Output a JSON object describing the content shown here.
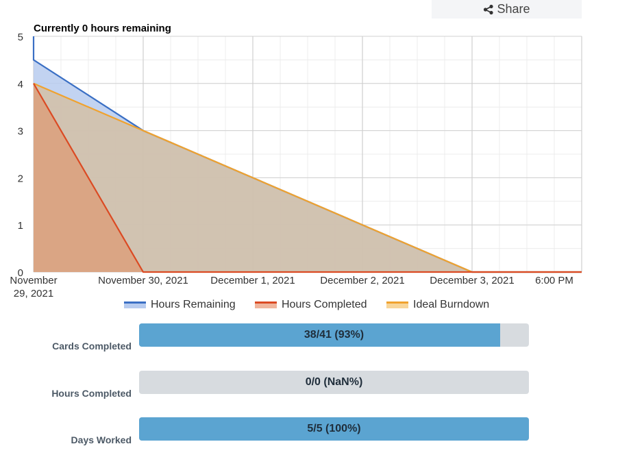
{
  "share": {
    "label": "Share",
    "icon": "share-icon"
  },
  "chart_data": {
    "type": "area",
    "title": "Currently 0 hours remaining",
    "xlabel": "",
    "ylabel": "",
    "ylim": [
      0,
      5
    ],
    "yticks": [
      0,
      1,
      2,
      3,
      4,
      5
    ],
    "grid": true,
    "legend_position": "bottom",
    "x_ticks": [
      {
        "x": "2021-11-29 00:00",
        "label": "November 29, 2021"
      },
      {
        "x": "2021-11-30 00:00",
        "label": "November 30, 2021"
      },
      {
        "x": "2021-12-01 00:00",
        "label": "December 1, 2021"
      },
      {
        "x": "2021-12-02 00:00",
        "label": "December 2, 2021"
      },
      {
        "x": "2021-12-03 00:00",
        "label": "December 3, 2021"
      },
      {
        "x": "2021-12-03 18:00",
        "label": "6:00 PM"
      }
    ],
    "xlim": [
      "2021-11-29 00:00",
      "2021-12-04 00:00"
    ],
    "series": [
      {
        "name": "Hours Remaining",
        "color": "#3a6fc4",
        "fill": "#b7cbef",
        "points": [
          [
            "2021-11-29 00:00",
            5
          ],
          [
            "2021-11-29 00:00",
            4.5
          ],
          [
            "2021-11-30 00:00",
            3
          ],
          [
            "2021-12-01 00:00",
            2
          ],
          [
            "2021-12-02 00:00",
            1
          ],
          [
            "2021-12-03 00:00",
            0
          ],
          [
            "2021-12-04 00:00",
            0
          ]
        ]
      },
      {
        "name": "Ideal Burndown",
        "color": "#f0a22e",
        "fill": "#d3bfa6",
        "points": [
          [
            "2021-11-29 00:00",
            4
          ],
          [
            "2021-12-03 00:00",
            0
          ],
          [
            "2021-12-04 00:00",
            0
          ]
        ]
      },
      {
        "name": "Hours Completed",
        "color": "#db4a23",
        "fill": "#dca07c",
        "points": [
          [
            "2021-11-29 00:00",
            4
          ],
          [
            "2021-11-30 00:00",
            0
          ],
          [
            "2021-12-04 00:00",
            0
          ]
        ]
      }
    ]
  },
  "stats": [
    {
      "label": "Cards Completed",
      "text": "38/41 (93%)",
      "fraction": 0.927
    },
    {
      "label": "Hours Completed",
      "text": "0/0 (NaN%)",
      "fraction": 0
    },
    {
      "label": "Days Worked",
      "text": "5/5 (100%)",
      "fraction": 1
    }
  ],
  "colors": {
    "progress_fill": "#5ba4d1",
    "progress_track": "#d7dbdf"
  }
}
